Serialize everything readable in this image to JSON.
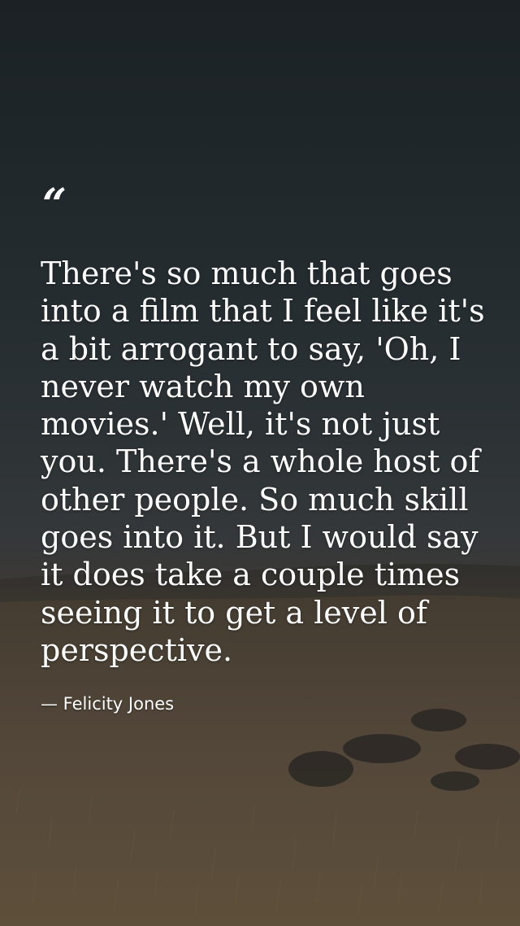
{
  "quote": {
    "mark": "“",
    "text": "There's so much that goes into a film that I feel like it's a bit arrogant to say, 'Oh, I never watch my own movies.' Well, it's not just you. There's a whole host of other people. So much skill goes into it. But I would say it does take a couple times seeing it to get a level of perspective.",
    "author": "— Felicity Jones"
  },
  "colors": {
    "sky_top": "#1b2125",
    "sky_horizon": "#34383a",
    "grass": "#5f5039",
    "text": "#ffffff"
  }
}
